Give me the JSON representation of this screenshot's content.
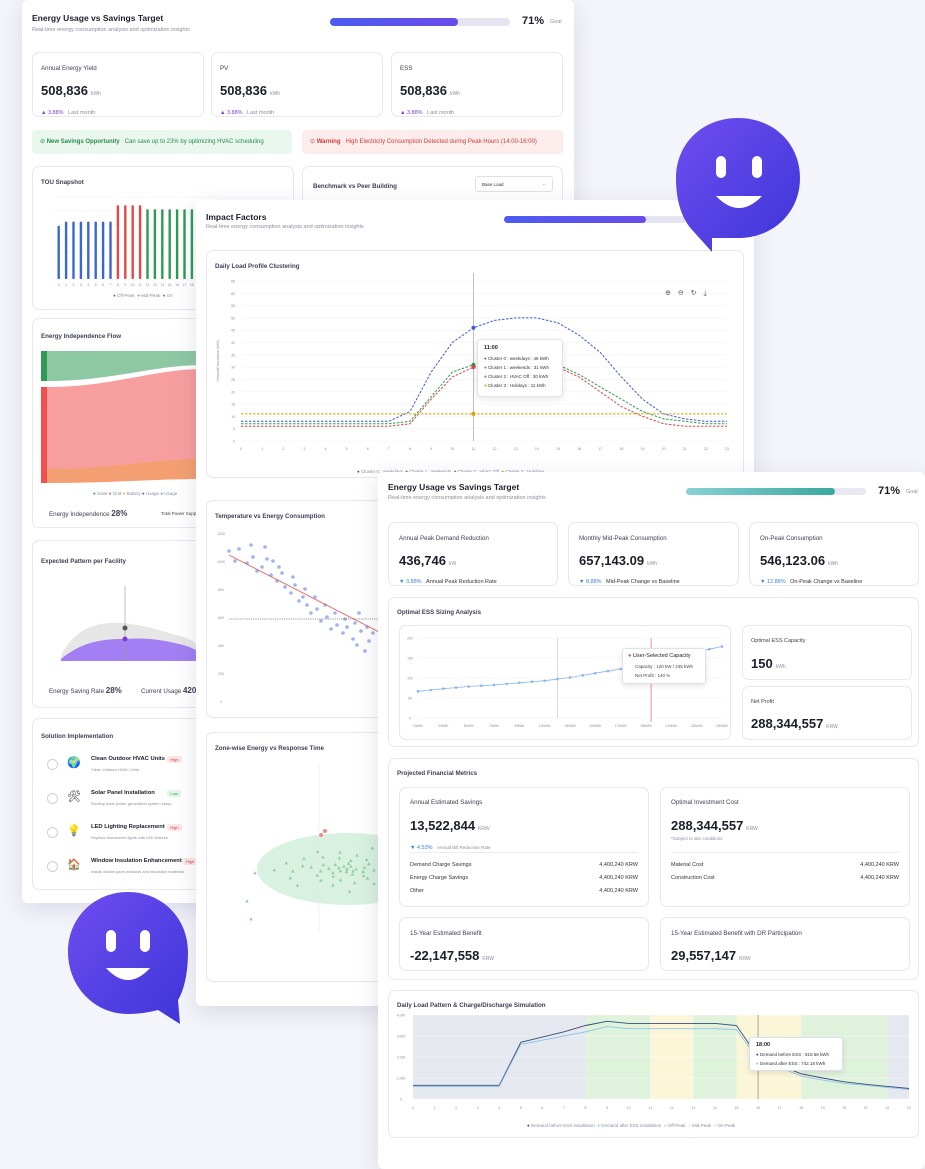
{
  "panel_a": {
    "title": "Energy Usage vs Savings Target",
    "subtitle": "Real-time energy consumption analysis and optimization insights",
    "goal": {
      "percent_label": "71%",
      "goal_label": "Goal",
      "progress": 0.71
    },
    "kpis": [
      {
        "label": "Annual Energy Yield",
        "value": "508,836",
        "unit": "kWh",
        "change": "▲ 3.88%",
        "change_note": "Last month"
      },
      {
        "label": "PV",
        "value": "508,836",
        "unit": "kWh",
        "change": "▲ 3.88%",
        "change_note": "Last month"
      },
      {
        "label": "ESS",
        "value": "508,836",
        "unit": "kWh",
        "change": "▲ 3.88%",
        "change_note": "Last month"
      }
    ],
    "alert_success": {
      "title": "New Savings Opportunity",
      "text": "Can save up to 23% by optimizing HVAC scheduling"
    },
    "alert_warning": {
      "title": "Warning",
      "text": "High Electricity Consumption Detected during Peak Hours (14:00-16:00)"
    },
    "tou": {
      "title": "TOU Snapshot",
      "legend": [
        "Off-Peak",
        "Mid-Peak",
        "On"
      ]
    },
    "benchmark": {
      "title": "Benchmark vs Peer Building",
      "select": "Base Load"
    },
    "flow": {
      "title": "Energy Independence Flow",
      "legend": [
        "Solar",
        "Grid",
        "Battery",
        "Usage",
        "Usage"
      ],
      "independence_label": "Energy Independence",
      "independence_value": "28%",
      "total_label": "Total Power Supply"
    },
    "pattern": {
      "title": "Expected Pattern per Facility",
      "saving_label": "Energy Saving Rate",
      "saving_value": "28%",
      "usage_label": "Current Usage",
      "usage_value": "420"
    },
    "solutions": {
      "title": "Solution Implementation",
      "items": [
        {
          "name": "Clean Outdoor HVAC Units",
          "tag": "High",
          "desc": "Clean Outdoor HVAC Units"
        },
        {
          "name": "Solar Panel Installation",
          "tag": "Low",
          "desc": "Rooftop solar power generation system setup"
        },
        {
          "name": "LED Lighting Replacement",
          "tag": "High",
          "desc": "Replace fluorescent lights with LED fixtures"
        },
        {
          "name": "Window Insulation Enhancement",
          "tag": "High",
          "desc": "Install double-pane windows and insulation materials"
        }
      ]
    }
  },
  "panel_b": {
    "title": "Impact Factors",
    "subtitle": "Real-time energy consumption analysis and optimization insights",
    "progress": 0.78,
    "cluster": {
      "title": "Daily Load Profile Clustering",
      "ylabel": "Demand/Consumption (kWh)",
      "tooltip": {
        "time": "11:00",
        "rows": [
          "Cluster 0 : weekdays : 46 kWh",
          "Cluster 1 : weekends : 31 kWh",
          "Cluster 2 : HVAC Off : 30 kWh",
          "Cluster 3 : Holidays : 11 kWh"
        ]
      },
      "legend": [
        "Cluster 0 : weekdays",
        "Cluster 1 : weekends",
        "Cluster 2 : HVAC Off",
        "Cluster 3 : Holidays"
      ]
    },
    "temp": {
      "title": "Temperature vs Energy Consumption"
    },
    "zone": {
      "title": "Zone-wise Energy vs Response Time"
    }
  },
  "panel_c": {
    "title": "Energy Usage vs Savings Target",
    "subtitle": "Real-time energy consumption analysis and optimization insights",
    "goal": {
      "percent_label": "71%",
      "goal_label": "Goal",
      "progress": 0.83
    },
    "kpis": [
      {
        "label": "Annual Peak Demand Reduction",
        "value": "436,746",
        "unit": "kW",
        "change": "▼ 3.88%",
        "change_note": "Annual Peak Reduction Rate"
      },
      {
        "label": "Monthly Mid-Peak Consumption",
        "value": "657,143.09",
        "unit": "kWh",
        "change": "▼ 8.88%",
        "change_note": "Mid-Peak Change vs Baseline"
      },
      {
        "label": "On-Peak Consumption",
        "value": "546,123.06",
        "unit": "kWh",
        "change": "▼ 12.88%",
        "change_note": "On-Peak Change vs Baseline"
      }
    ],
    "ess": {
      "title": "Optimal ESS Sizing Analysis",
      "tooltip": {
        "title": "User-Selected Capacity",
        "line1": "Capacity : 120 kW / 235 kWh",
        "line2": "Net Profit : 140 %"
      },
      "capacity_label": "Optimal ESS Capacity",
      "capacity_value": "150",
      "capacity_unit": "kWh",
      "profit_label": "Net Profit",
      "profit_value": "288,344,557",
      "profit_unit": "KRW",
      "x_ticks": [
        "10kWh",
        "30kWh",
        "50kWh",
        "70kWh",
        "90kWh",
        "110kWh",
        "130kWh",
        "150kWh",
        "170kWh",
        "190kWh",
        "210kWh",
        "230kWh",
        "250kWh"
      ]
    },
    "financial": {
      "title": "Projected Financial Metrics",
      "savings_label": "Annual Estimated Savings",
      "savings_value": "13,522,844",
      "savings_unit": "KRW",
      "savings_change": "▼ 4.53%",
      "savings_change_note": "Annual Bill Reduction Rate",
      "rows_left": [
        {
          "label": "Demand Charge Savings",
          "value": "4,400,240 KRW"
        },
        {
          "label": "Energy Charge Savings",
          "value": "4,400,240 KRW"
        },
        {
          "label": "Other",
          "value": "4,400,240 KRW"
        }
      ],
      "invest_label": "Optimal Investment Cost",
      "invest_value": "288,344,557",
      "invest_unit": "KRW",
      "invest_note": "*Subject to site conditions",
      "rows_right": [
        {
          "label": "Material Cost",
          "value": "4,400,240 KRW"
        },
        {
          "label": "Construction Cost",
          "value": "4,400,240 KRW"
        }
      ],
      "benefit15_label": "15-Year Estimated Benefit",
      "benefit15_value": "-22,147,558",
      "benefit15_unit": "KRW",
      "benefit15dr_label": "15-Year Estimated Benefit with DR Participation",
      "benefit15dr_value": "29,557,147",
      "benefit15dr_unit": "KRW"
    },
    "sim": {
      "title": "Daily Load Pattern & Charge/Discharge Simulation",
      "y_ticks": [
        "4,000",
        "3,000",
        "2,000",
        "1,000",
        "0"
      ],
      "tooltip": {
        "time": "18:00",
        "row1": "Demand before ESS : 819.68 kWh",
        "row2": "Demand after ESS : 742.18 kWh"
      },
      "legend": [
        "Demand before ESS installation",
        "Demand after ESS installation",
        "Off-Peak",
        "Mid-Peak",
        "On-Peak"
      ]
    }
  },
  "chart_data": [
    {
      "type": "bar",
      "title": "TOU Snapshot",
      "categories": [
        "0",
        "1",
        "2",
        "3",
        "4",
        "5",
        "6",
        "7",
        "8",
        "9",
        "10",
        "11",
        "12",
        "13",
        "14",
        "15",
        "16",
        "17",
        "18",
        "19"
      ],
      "values": [
        0.065,
        0.07,
        0.07,
        0.07,
        0.07,
        0.07,
        0.07,
        0.07,
        0.09,
        0.09,
        0.09,
        0.09,
        0.085,
        0.085,
        0.085,
        0.085,
        0.085,
        0.085,
        0.085,
        0.085
      ],
      "series_colors": [
        "#3a66d6",
        "#3a66d6",
        "#3a66d6",
        "#3a66d6",
        "#3a66d6",
        "#3a66d6",
        "#3a66d6",
        "#3a66d6",
        "#e24848",
        "#e24848",
        "#e24848",
        "#e24848",
        "#2f9a55",
        "#2f9a55",
        "#2f9a55",
        "#2f9a55",
        "#2f9a55",
        "#2f9a55",
        "#2f9a55",
        "#2f9a55"
      ],
      "ylim": [
        0,
        0.1
      ]
    },
    {
      "type": "line",
      "title": "Daily Load Profile Clustering",
      "x": [
        0,
        1,
        2,
        3,
        4,
        5,
        6,
        7,
        8,
        9,
        10,
        11,
        12,
        13,
        14,
        15,
        16,
        17,
        18,
        19,
        20,
        21,
        22,
        23
      ],
      "series": [
        {
          "name": "Cluster 0 : weekdays",
          "color": "#3b5bdb",
          "values": [
            8,
            8,
            8,
            8,
            8,
            8,
            8,
            8,
            12,
            28,
            40,
            46,
            49,
            50,
            50,
            48,
            43,
            36,
            26,
            17,
            11,
            9,
            8,
            8
          ]
        },
        {
          "name": "Cluster 1 : weekends",
          "color": "#2f9a55",
          "values": [
            7,
            7,
            7,
            7,
            7,
            7,
            7,
            7,
            8,
            18,
            28,
            31,
            33,
            34,
            33,
            31,
            27,
            22,
            17,
            12,
            9,
            8,
            7,
            7
          ]
        },
        {
          "name": "Cluster 2 : HVAC Off",
          "color": "#d94a4a",
          "values": [
            6,
            6,
            6,
            6,
            6,
            6,
            6,
            6,
            7,
            17,
            26,
            30,
            33,
            33,
            32,
            30,
            26,
            20,
            14,
            10,
            7,
            6,
            6,
            6
          ]
        },
        {
          "name": "Cluster 3 : Holidays",
          "color": "#e0a100",
          "values": [
            11,
            11,
            11,
            11,
            11,
            11,
            11,
            11,
            11,
            11,
            11,
            11,
            11,
            11,
            11,
            11,
            11,
            11,
            11,
            11,
            11,
            11,
            11,
            11
          ]
        }
      ],
      "ylim": [
        0,
        65
      ]
    },
    {
      "type": "line",
      "title": "Optimal ESS Sizing Analysis",
      "x": [
        "10kWh",
        "30kWh",
        "50kWh",
        "70kWh",
        "90kWh",
        "110kWh",
        "130kWh",
        "150kWh",
        "170kWh",
        "190kWh",
        "210kWh",
        "230kWh",
        "250kWh"
      ],
      "series": [
        {
          "color": "#8ab6ee",
          "values": [
            50,
            55,
            59,
            62,
            66,
            70,
            76,
            84,
            92,
            104,
            114,
            124,
            134
          ]
        }
      ]
    },
    {
      "type": "line",
      "title": "Daily Load Pattern & Charge/Discharge Simulation",
      "x": [
        0,
        1,
        2,
        3,
        4,
        5,
        6,
        7,
        8,
        9,
        10,
        11,
        12,
        13,
        14,
        15,
        16,
        17,
        18,
        19,
        20,
        21,
        22,
        23
      ],
      "series": [
        {
          "name": "Demand before ESS installation",
          "color": "#3a4a7a",
          "values": [
            650,
            650,
            650,
            650,
            650,
            2700,
            2950,
            3200,
            3500,
            3700,
            3600,
            3600,
            3600,
            3600,
            3600,
            3500,
            2000,
            1600,
            1200,
            1000,
            820,
            700,
            600,
            500
          ]
        },
        {
          "name": "Demand after ESS installation",
          "color": "#8ec3ea",
          "values": [
            600,
            600,
            600,
            600,
            600,
            2600,
            2800,
            3000,
            3200,
            3450,
            3350,
            3350,
            3350,
            3350,
            3350,
            3300,
            1900,
            1500,
            1100,
            900,
            742,
            650,
            550,
            450
          ]
        }
      ],
      "ylim": [
        0,
        4000
      ]
    }
  ]
}
